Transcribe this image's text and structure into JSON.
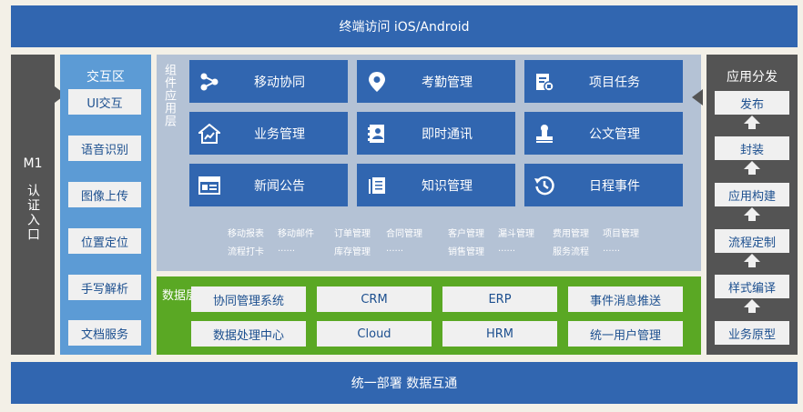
{
  "top_band": "终端访问 iOS/Android",
  "bottom_band": "统一部署 数据互通",
  "m1": {
    "title": "M1",
    "label": "认证入口"
  },
  "interaction": {
    "title": "交互区",
    "items": [
      "UI交互",
      "语音识别",
      "图像上传",
      "位置定位",
      "手写解析",
      "文档服务"
    ]
  },
  "component_layer": {
    "title": "组件应用层",
    "tiles": [
      {
        "label": "移动协同",
        "icon": "share-icon"
      },
      {
        "label": "考勤管理",
        "icon": "location-pin-icon"
      },
      {
        "label": "项目任务",
        "icon": "document-icon"
      },
      {
        "label": "业务管理",
        "icon": "home-chart-icon"
      },
      {
        "label": "即时通讯",
        "icon": "contact-card-icon"
      },
      {
        "label": "公文管理",
        "icon": "stamp-icon"
      },
      {
        "label": "新闻公告",
        "icon": "news-icon"
      },
      {
        "label": "知识管理",
        "icon": "book-icon"
      },
      {
        "label": "日程事件",
        "icon": "history-icon"
      }
    ],
    "tags_row1": [
      "移动报表",
      "移动邮件",
      "订单管理",
      "合同管理",
      "客户管理",
      "漏斗管理",
      "费用管理",
      "项目管理"
    ],
    "tags_row2": [
      "流程打卡",
      "......",
      "库存管理",
      "......",
      "销售管理",
      "......",
      "服务流程",
      "......"
    ]
  },
  "data_layer": {
    "title": "数据层",
    "items": [
      "协同管理系统",
      "CRM",
      "ERP",
      "事件消息推送",
      "数据处理中心",
      "Cloud",
      "HRM",
      "统一用户管理"
    ]
  },
  "distribution": {
    "title": "应用分发",
    "items": [
      "发布",
      "封装",
      "应用构建",
      "流程定制",
      "样式编译",
      "业务原型"
    ]
  },
  "colors": {
    "blue": "#3166b0",
    "light_blue": "#5c9bd5",
    "green": "#5aa824",
    "gray": "#545454",
    "slate": "#b4c2d5"
  }
}
